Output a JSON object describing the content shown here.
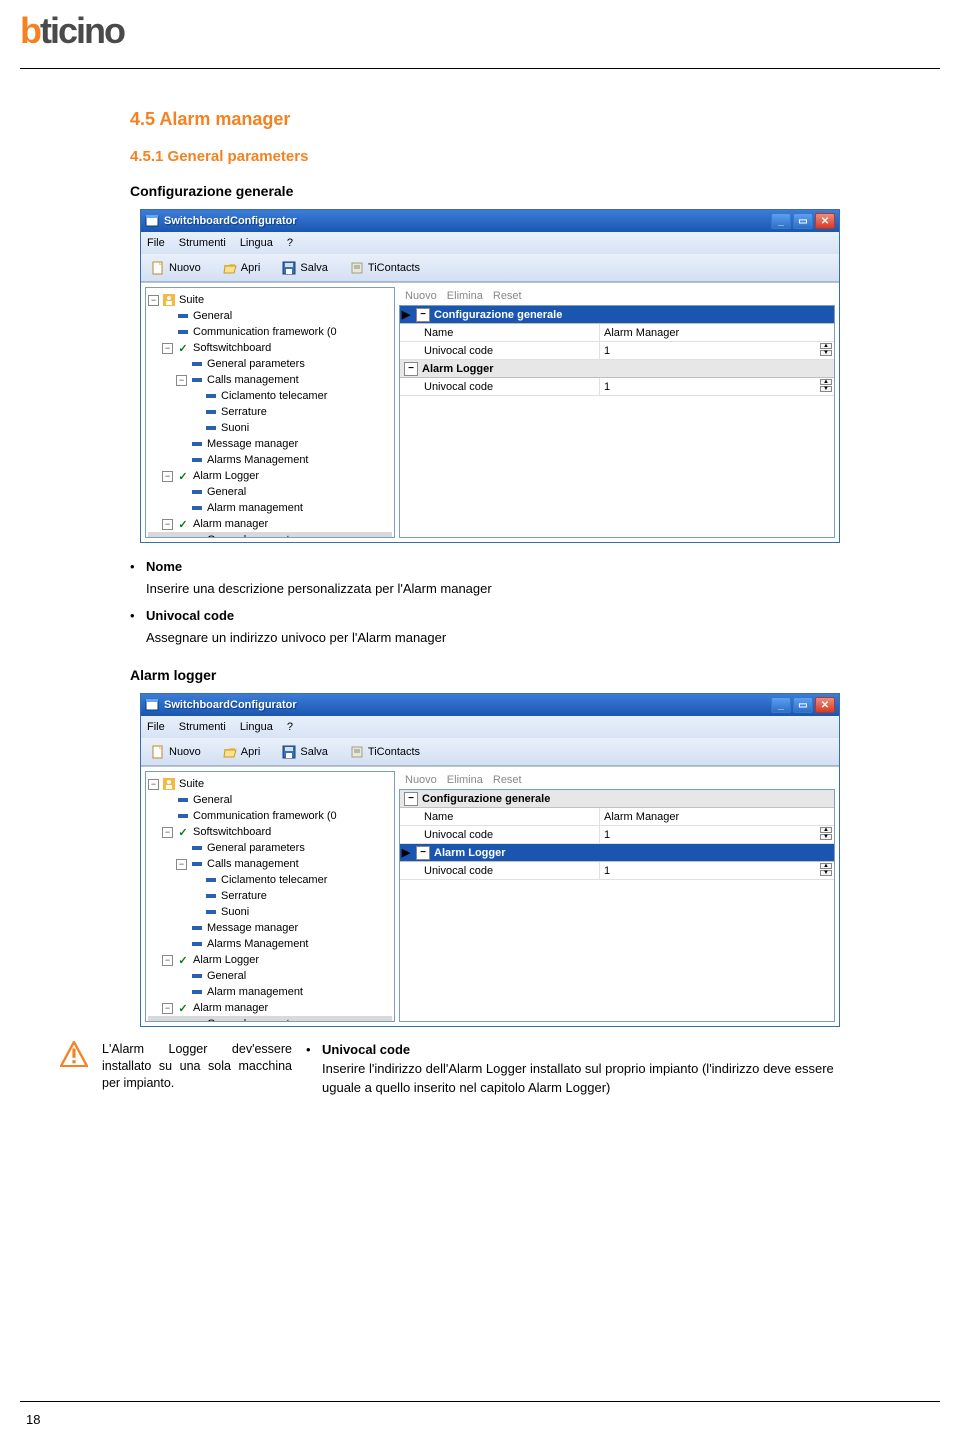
{
  "brand": {
    "pre": "b",
    "post": "ticino"
  },
  "section_title": "4.5   Alarm manager",
  "subsection_title": "4.5.1 General parameters",
  "topic1": "Configurazione generale",
  "bullets1": {
    "nome_label": "Nome",
    "nome_desc": "Inserire una descrizione personalizzata per l'Alarm manager",
    "uc_label": "Univocal code",
    "uc_desc": "Assegnare un indirizzo univoco per l'Alarm manager"
  },
  "topic2": "Alarm logger",
  "warn_note": "L'Alarm Logger dev'essere installato su una sola macchina per impianto.",
  "bullets2": {
    "uc_label": "Univocal code",
    "uc_desc": "Inserire l'indirizzo dell'Alarm Logger installato sul proprio impianto (l'indirizzo deve essere uguale a quello inserito nel capitolo Alarm Logger)"
  },
  "page_number": "18",
  "win_common": {
    "title": "SwitchboardConfigurator",
    "menu": {
      "file": "File",
      "strumenti": "Strumenti",
      "lingua": "Lingua",
      "help": "?"
    },
    "toolbar": {
      "nuovo": "Nuovo",
      "apri": "Apri",
      "salva": "Salva",
      "ticontacts": "TiContacts"
    },
    "prop_btns": {
      "nuovo": "Nuovo",
      "elimina": "Elimina",
      "reset": "Reset"
    },
    "tree": {
      "suite": "Suite",
      "general": "General",
      "commfw": "Communication framework (0",
      "softsb": "Softswitchboard",
      "genparams": "General parameters",
      "callsmgmt": "Calls management",
      "cicl": "Ciclamento telecamer",
      "serr": "Serrature",
      "suoni": "Suoni",
      "msgmgr": "Message manager",
      "alarmsmgmt": "Alarms Management",
      "alarmlogger": "Alarm Logger",
      "al_general": "General",
      "al_mgmt": "Alarm management",
      "alarmmgr": "Alarm manager",
      "am_genparams": "General parameters"
    },
    "prop": {
      "h_conf": "Configurazione generale",
      "r_name_k": "Name",
      "r_name_v": "Alarm Manager",
      "r_uc_k": "Univocal code",
      "r_uc_v": "1",
      "h_logger": "Alarm Logger",
      "r_uc2_k": "Univocal code",
      "r_uc2_v": "1"
    }
  }
}
